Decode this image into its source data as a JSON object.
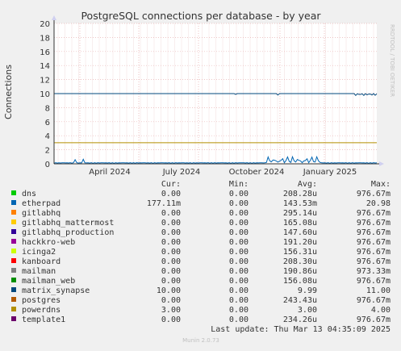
{
  "title": "PostgreSQL connections per database - by year",
  "side_label": "RRDTOOL / TOBI OETIKER",
  "footer": {
    "last_update": "Last update: Thu Mar 13 04:35:09 2025",
    "munin": "Munin 2.0.73"
  },
  "legend_headers": {
    "cur": "Cur:",
    "min": "Min:",
    "avg": "Avg:",
    "max": "Max:"
  },
  "chart_data": {
    "type": "line",
    "title": "PostgreSQL connections per database - by year",
    "ylabel": "Connections",
    "xlabel": "",
    "ylim": [
      0,
      20
    ],
    "yticks": [
      0,
      2,
      4,
      6,
      8,
      10,
      12,
      14,
      16,
      18,
      20
    ],
    "xticks": [
      "April 2024",
      "July 2024",
      "October 2024",
      "January 2025"
    ],
    "grid": true,
    "series": [
      {
        "name": "dns",
        "color": "#00cc00",
        "cur": "0.00",
        "min": "0.00",
        "avg": "208.28u",
        "max": "976.67m"
      },
      {
        "name": "etherpad",
        "color": "#0066b3",
        "cur": "177.11m",
        "min": "0.00",
        "avg": "143.53m",
        "max": "20.98"
      },
      {
        "name": "gitlabhq",
        "color": "#ff8000",
        "cur": "0.00",
        "min": "0.00",
        "avg": "295.14u",
        "max": "976.67m"
      },
      {
        "name": "gitlabhq_mattermost",
        "color": "#ffcc00",
        "cur": "0.00",
        "min": "0.00",
        "avg": "165.08u",
        "max": "976.67m"
      },
      {
        "name": "gitlabhq_production",
        "color": "#330099",
        "cur": "0.00",
        "min": "0.00",
        "avg": "147.60u",
        "max": "976.67m"
      },
      {
        "name": "hackkro-web",
        "color": "#990099",
        "cur": "0.00",
        "min": "0.00",
        "avg": "191.20u",
        "max": "976.67m"
      },
      {
        "name": "icinga2",
        "color": "#ccff00",
        "cur": "0.00",
        "min": "0.00",
        "avg": "156.31u",
        "max": "976.67m"
      },
      {
        "name": "kanboard",
        "color": "#ff0000",
        "cur": "0.00",
        "min": "0.00",
        "avg": "208.30u",
        "max": "976.67m"
      },
      {
        "name": "mailman",
        "color": "#808080",
        "cur": "0.00",
        "min": "0.00",
        "avg": "190.86u",
        "max": "973.33m"
      },
      {
        "name": "mailman_web",
        "color": "#008f00",
        "cur": "0.00",
        "min": "0.00",
        "avg": "156.08u",
        "max": "976.67m"
      },
      {
        "name": "matrix_synapse",
        "color": "#00487d",
        "cur": "10.00",
        "min": "0.00",
        "avg": "9.99",
        "max": "11.00"
      },
      {
        "name": "postgres",
        "color": "#b35a00",
        "cur": "0.00",
        "min": "0.00",
        "avg": "243.43u",
        "max": "976.67m"
      },
      {
        "name": "powerdns",
        "color": "#b38f00",
        "cur": "3.00",
        "min": "0.00",
        "avg": "3.00",
        "max": "4.00"
      },
      {
        "name": "template1",
        "color": "#6b006b",
        "cur": "0.00",
        "min": "0.00",
        "avg": "234.26u",
        "max": "976.67m"
      }
    ]
  }
}
